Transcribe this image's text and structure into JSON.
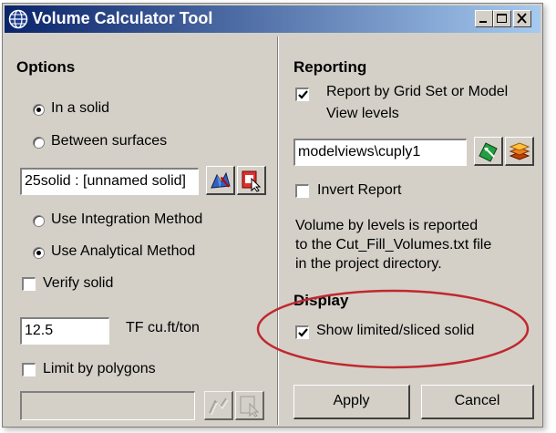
{
  "window": {
    "title": "Volume Calculator Tool"
  },
  "title_controls": [
    "minimize",
    "maximize",
    "close"
  ],
  "options": {
    "heading": "Options",
    "radio_solid": "In a solid",
    "radio_surfaces": "Between surfaces",
    "selected_source": "solid",
    "solid_field": "25solid : [unnamed solid]",
    "radio_integration": "Use Integration Method",
    "radio_analytical": "Use Analytical Method",
    "selected_method": "analytical",
    "verify_solid": "Verify solid",
    "verify_solid_checked": false,
    "tf_value": "12.5",
    "tf_label": "TF  cu.ft/ton",
    "limit_polygons": "Limit by polygons",
    "limit_polygons_checked": false,
    "polygon_field": ""
  },
  "reporting": {
    "heading": "Reporting",
    "report_by_levels_line1": "Report by Grid Set or Model",
    "report_by_levels_line2": "View levels",
    "report_by_levels_checked": true,
    "views_field": "modelviews\\cuply1",
    "invert_report": "Invert Report",
    "invert_report_checked": false,
    "info_line1": "Volume by levels is reported",
    "info_line2": "to  the Cut_Fill_Volumes.txt file",
    "info_line3": "in the project directory."
  },
  "display": {
    "heading": "Display",
    "show_limited": "Show limited/sliced solid",
    "show_limited_checked": true
  },
  "buttons": {
    "apply": "Apply",
    "cancel": "Cancel"
  },
  "colors": {
    "titlebar_start": "#0a246a",
    "titlebar_end": "#a6caf0",
    "annotation_ellipse": "#c0282e",
    "face": "#d4d0c8"
  },
  "icons": [
    "globe-icon",
    "pick-solid-icon",
    "select-solid-icon",
    "pick-view-icon",
    "layers-icon",
    "pick-polygon-icon",
    "select-polygon-icon"
  ]
}
